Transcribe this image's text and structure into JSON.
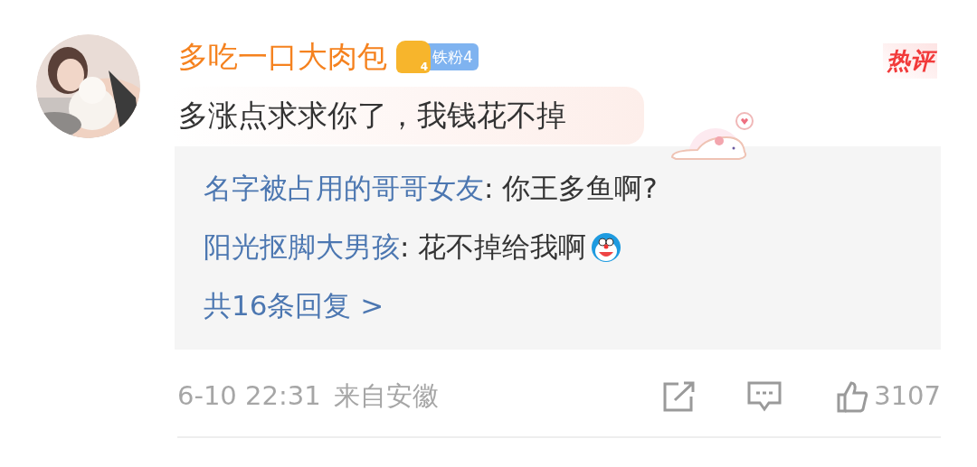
{
  "comment": {
    "username": "多吃一口大肉包",
    "fan_badge": {
      "level_digit": "4",
      "label": "铁粉4"
    },
    "hot_tag": "热评",
    "text": "多涨点求求你了，我钱花不掉"
  },
  "replies": [
    {
      "user": "名字被占用的哥哥女友",
      "text": ": 你王多鱼啊?",
      "emoji": false
    },
    {
      "user": "阳光抠脚大男孩",
      "text": ": 花不掉给我啊",
      "emoji": true
    }
  ],
  "more_replies": "共16条回复 >",
  "footer": {
    "time": "6-10 22:31",
    "source": "来自安徽",
    "like_count": "3107"
  }
}
